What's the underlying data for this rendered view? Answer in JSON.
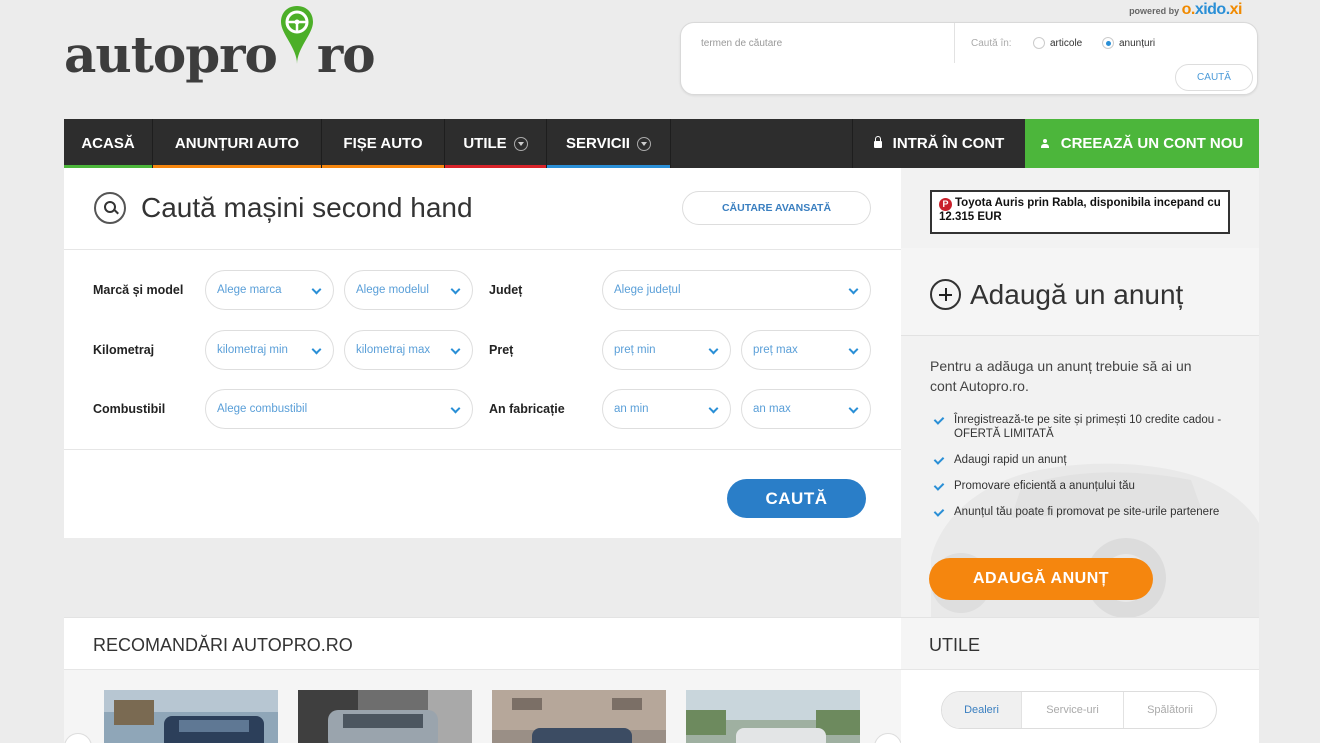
{
  "logo": {
    "part1": "autopro",
    "part2": "ro"
  },
  "powered": {
    "prefix": "powered by",
    "brand_a": "o.",
    "brand_b": "xido.",
    "brand_c": "xi"
  },
  "search": {
    "placeholder": "termen de căutare",
    "cauta_in": "Caută în:",
    "options": [
      "articole",
      "anunțuri"
    ],
    "selected": "anunțuri",
    "button": "CAUTĂ"
  },
  "nav": {
    "items": [
      {
        "label": "ACASĂ",
        "color": "#4cb63b"
      },
      {
        "label": "ANUNȚURI AUTO",
        "color": "#f5860e"
      },
      {
        "label": "FIȘE AUTO",
        "color": "#f5860e"
      },
      {
        "label": "UTILE",
        "color": "#d8232a"
      },
      {
        "label": "SERVICII",
        "color": "#2a8fd6"
      }
    ],
    "login": "INTRĂ ÎN CONT",
    "register": "CREEAZĂ UN CONT NOU"
  },
  "panel": {
    "title": "Caută mașini second hand",
    "advanced": "CĂUTARE AVANSATĂ",
    "labels": {
      "brand": "Marcă și model",
      "km": "Kilometraj",
      "fuel": "Combustibil",
      "county": "Județ",
      "price": "Preț",
      "year": "An fabricație"
    },
    "selects": {
      "brand": "Alege marca",
      "model": "Alege modelul",
      "km_min": "kilometraj min",
      "km_max": "kilometraj max",
      "fuel": "Alege combustibil",
      "county": "Alege județul",
      "price_min": "preț min",
      "price_max": "preț max",
      "year_min": "an min",
      "year_max": "an max"
    },
    "submit": "CAUTĂ"
  },
  "sidebar": {
    "promo": "Toyota Auris prin Rabla, disponibila incepand cu 12.315 EUR",
    "promo_icon": "P",
    "add_title": "Adaugă un anunț",
    "add_text": "Pentru a adăuga un anunț trebuie să ai un cont Autopro.ro.",
    "benefits": [
      "Înregistrează-te pe site și primești 10 credite cadou - OFERTĂ LIMITATĂ",
      "Adaugi rapid un anunț",
      "Promovare eficientă a anunțului tău",
      "Anunțul tău poate fi promovat pe site-urile partenere"
    ],
    "add_button": "ADAUGĂ ANUNȚ"
  },
  "recommended": {
    "title": "RECOMANDĂRI AUTOPRO.RO"
  },
  "utile": {
    "title": "UTILE",
    "tabs": [
      "Dealeri",
      "Service-uri",
      "Spălătorii"
    ]
  },
  "colors": {
    "green": "#4cb63b",
    "orange": "#f5860e",
    "blue": "#2a8fd6",
    "dark": "#2d2d2d"
  }
}
